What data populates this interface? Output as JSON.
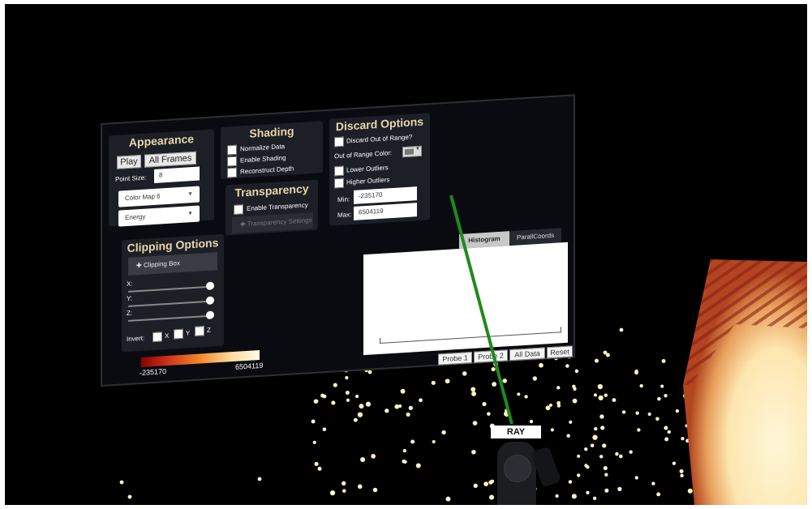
{
  "appearance": {
    "title": "Appearance",
    "play_label": "Play",
    "all_frames_label": "All Frames",
    "point_size_label": "Point Size:",
    "point_size_value": "8",
    "colormap_value": "Color Map 6",
    "variable_value": "Energy"
  },
  "shading": {
    "title": "Shading",
    "normalize_label": "Normalize Data",
    "enable_shading_label": "Enable Shading",
    "reconstruct_depth_label": "Reconstruct Depth"
  },
  "transparency": {
    "title": "Transparency",
    "enable_label": "Enable Transparency",
    "settings_label": "Transparency Settings"
  },
  "discard": {
    "title": "Discard Options",
    "discard_label": "Discard Out of Range?",
    "out_color_label": "Out of Range Color:",
    "lower_label": "Lower Outliers",
    "higher_label": "Higher Outliers",
    "min_label": "Min:",
    "min_value": "-235170",
    "max_label": "Max:",
    "max_value": "6504119"
  },
  "clipping": {
    "title": "Clipping Options",
    "box_label": "Clipping Box",
    "x_label": "X:",
    "y_label": "Y:",
    "z_label": "Z:",
    "invert_label": "Invert:",
    "invert_x": "X",
    "invert_y": "Y",
    "invert_z": "Z",
    "slider_x": 1.0,
    "slider_y": 1.0,
    "slider_z": 1.0
  },
  "colorbar": {
    "min_label": "-235170",
    "max_label": "6504119"
  },
  "plot": {
    "tab_histogram": "Histogram",
    "tab_parallel": "ParallCoords",
    "probe1": "Probe 1",
    "probe2": "Probe 2",
    "all_data": "All Data",
    "reset": "Reset"
  },
  "controller": {
    "ray_label": "RAY"
  },
  "icons": {
    "plus": "plus-icon",
    "caret": "chevron-down-icon"
  },
  "colors": {
    "section_title": "#e8d7a8",
    "ray": "#1a8a1a",
    "point": "#fff2c0"
  }
}
